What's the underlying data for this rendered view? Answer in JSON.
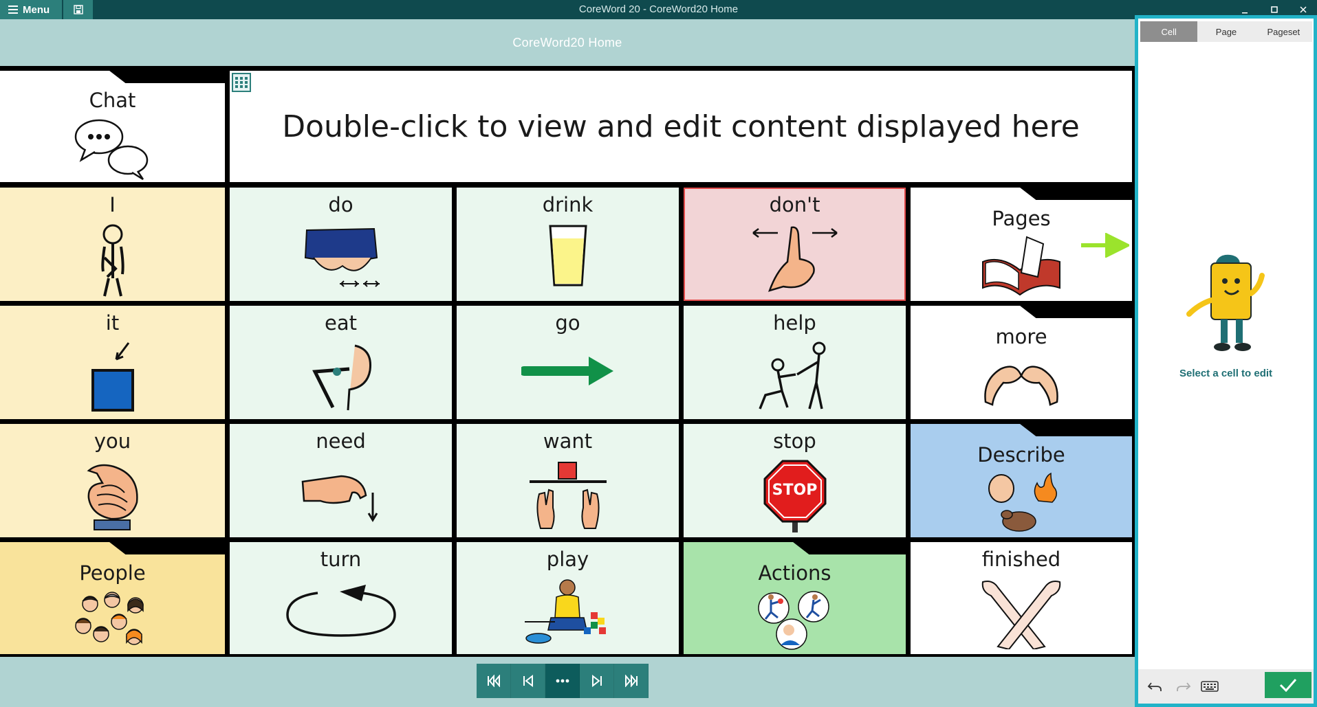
{
  "titlebar": {
    "menu_label": "Menu",
    "window_title": "CoreWord 20 - CoreWord20 Home",
    "controls": [
      "minimize-icon",
      "maximize-icon",
      "close-icon"
    ]
  },
  "page": {
    "title": "CoreWord20 Home",
    "message_placeholder": "Double-click to view and edit content displayed here"
  },
  "cells": {
    "chat": "Chat",
    "i": "I",
    "do": "do",
    "drink": "drink",
    "dont": "don't",
    "pages": "Pages",
    "it": "it",
    "eat": "eat",
    "go": "go",
    "help": "help",
    "more": "more",
    "you": "you",
    "need": "need",
    "want": "want",
    "stop": "stop",
    "stop_sign_text": "STOP",
    "describe": "Describe",
    "people": "People",
    "turn": "turn",
    "play": "play",
    "actions": "Actions",
    "finished": "finished"
  },
  "colors": {
    "pronoun_cell": "#fcefc5",
    "verb_cell": "#eaf7ee",
    "negation_cell": "#f2d4d6",
    "folder_white": "#ffffff",
    "describe_folder": "#a9cdee",
    "people_folder": "#f9e39b",
    "actions_folder": "#a8e3aa",
    "teal_accent": "#2c7f7b",
    "panel_border": "#22b3c8"
  },
  "footer_nav": [
    "first-page-icon",
    "previous-page-icon",
    "more-icon",
    "next-page-icon",
    "last-page-icon"
  ],
  "side_panel": {
    "tabs": [
      "Cell",
      "Page",
      "Pageset"
    ],
    "active_tab": "Cell",
    "hint": "Select a cell to edit"
  }
}
